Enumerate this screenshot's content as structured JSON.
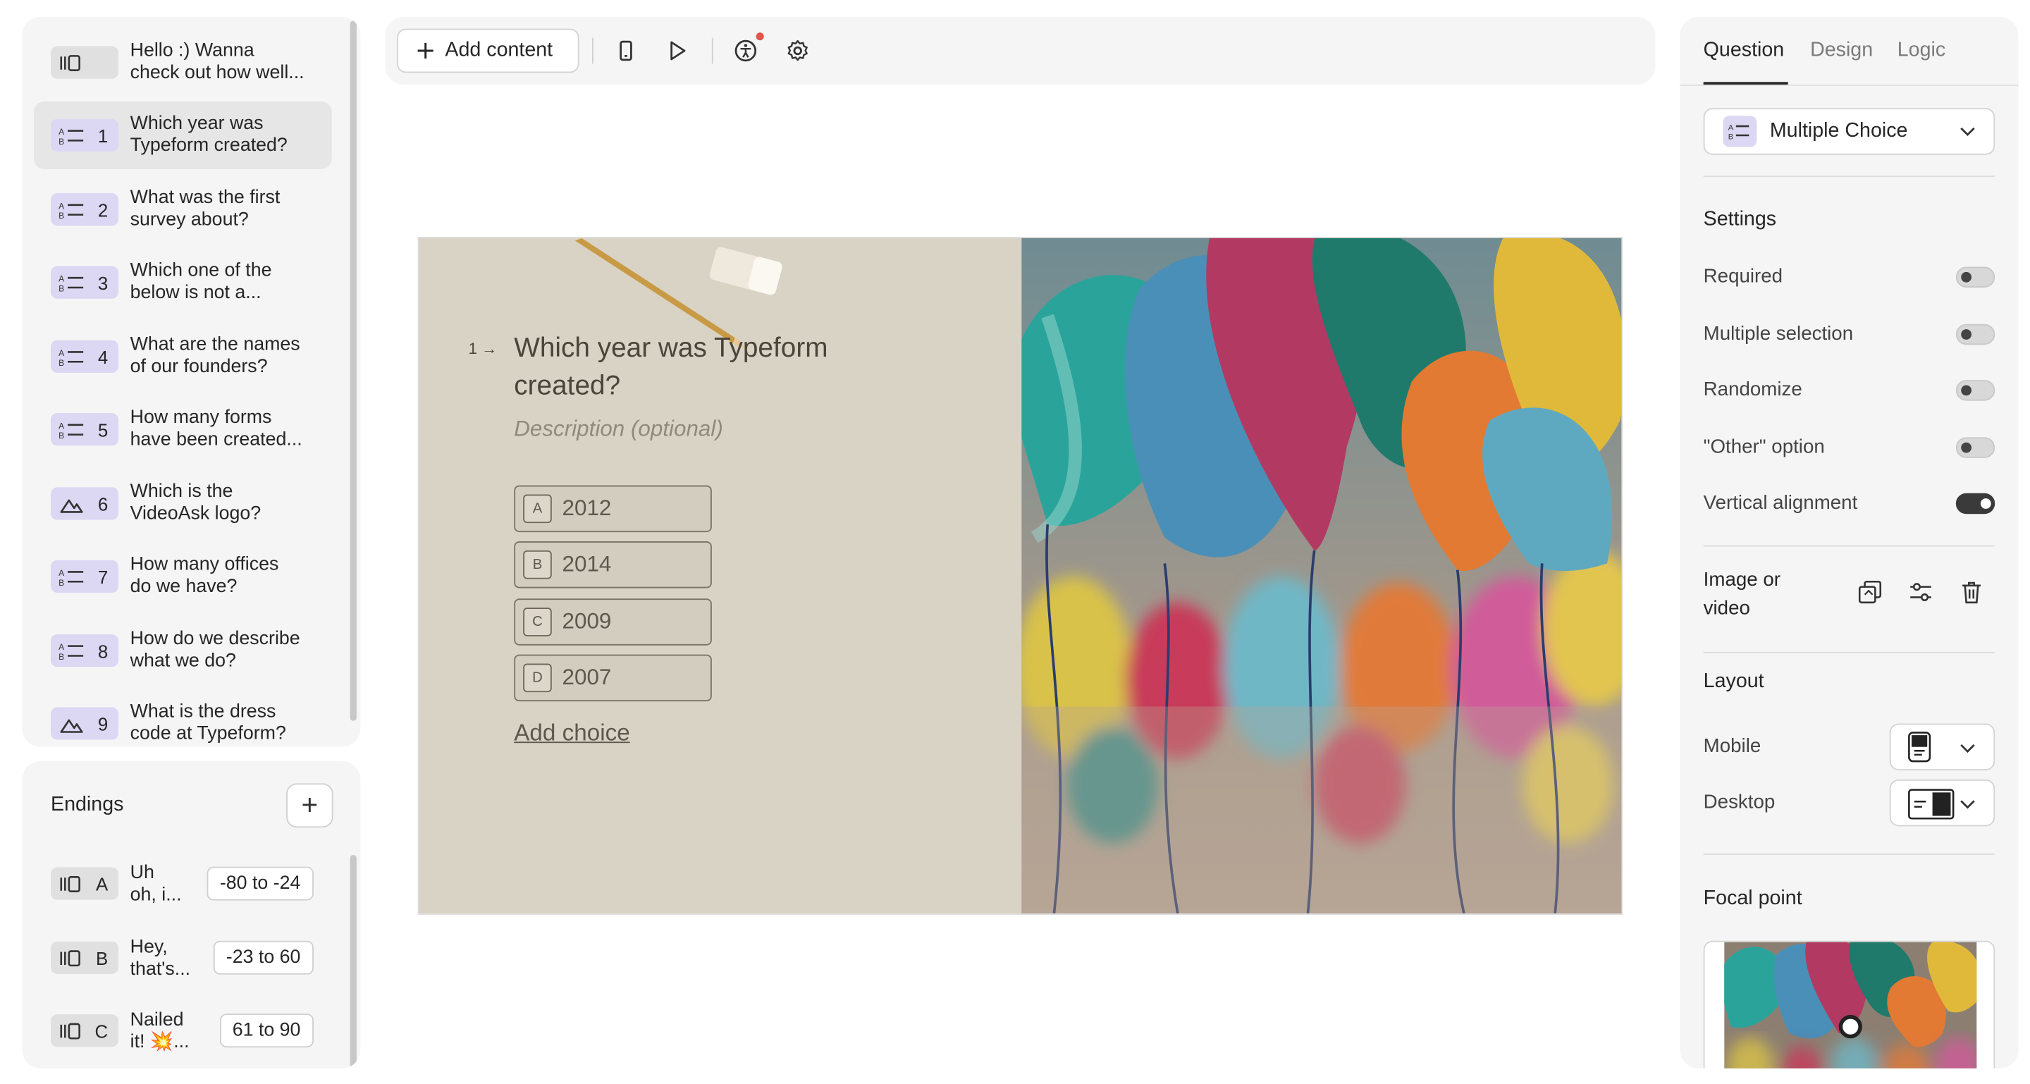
{
  "toolbar": {
    "add_content": "Add content"
  },
  "questions": [
    {
      "num": "",
      "text": "Hello :) Wanna\ncheck out how well...",
      "icon": "welcome-screen-icon"
    },
    {
      "num": "1",
      "text": "Which year was\nTypeform created?",
      "icon": "multiple-choice-icon"
    },
    {
      "num": "2",
      "text": "What was the first\nsurvey about?",
      "icon": "multiple-choice-icon"
    },
    {
      "num": "3",
      "text": "Which one of the\nbelow is not a...",
      "icon": "multiple-choice-icon"
    },
    {
      "num": "4",
      "text": "What are the names\nof our founders?",
      "icon": "multiple-choice-icon"
    },
    {
      "num": "5",
      "text": "How many forms\nhave been created...",
      "icon": "multiple-choice-icon"
    },
    {
      "num": "6",
      "text": "Which is the\nVideoAsk logo?",
      "icon": "picture-choice-icon"
    },
    {
      "num": "7",
      "text": "How many offices\ndo we have?",
      "icon": "multiple-choice-icon"
    },
    {
      "num": "8",
      "text": "How do we describe\nwhat we do?",
      "icon": "multiple-choice-icon"
    },
    {
      "num": "9",
      "text": "What is the dress\ncode at Typeform?",
      "icon": "picture-choice-icon"
    }
  ],
  "endings": {
    "title": "Endings",
    "items": [
      {
        "key": "A",
        "text": "Uh\noh, i...",
        "range": "-80 to -24"
      },
      {
        "key": "B",
        "text": "Hey,\nthat's...",
        "range": "-23 to 60"
      },
      {
        "key": "C",
        "text": "Nailed\nit! 💥...",
        "range": "61 to 90"
      }
    ]
  },
  "canvas": {
    "index": "1",
    "question": "Which year was Typeform created?",
    "description": "Description (optional)",
    "choices": [
      {
        "key": "A",
        "value": "2012"
      },
      {
        "key": "B",
        "value": "2014"
      },
      {
        "key": "C",
        "value": "2009"
      },
      {
        "key": "D",
        "value": "2007"
      }
    ],
    "add_choice": "Add choice"
  },
  "panel": {
    "tabs": [
      "Question",
      "Design",
      "Logic"
    ],
    "type": "Multiple Choice",
    "settings_title": "Settings",
    "settings": [
      {
        "label": "Required",
        "on": false
      },
      {
        "label": "Multiple selection",
        "on": false
      },
      {
        "label": "Randomize",
        "on": false
      },
      {
        "label": "\"Other\" option",
        "on": false
      },
      {
        "label": "Vertical alignment",
        "on": true
      }
    ],
    "media_label": "Image or\nvideo",
    "layout_title": "Layout",
    "mobile": "Mobile",
    "desktop": "Desktop",
    "focal_title": "Focal point"
  },
  "colors": {
    "accent_purple": "#dcd7f3",
    "card_bg": "#d8d3c5"
  }
}
